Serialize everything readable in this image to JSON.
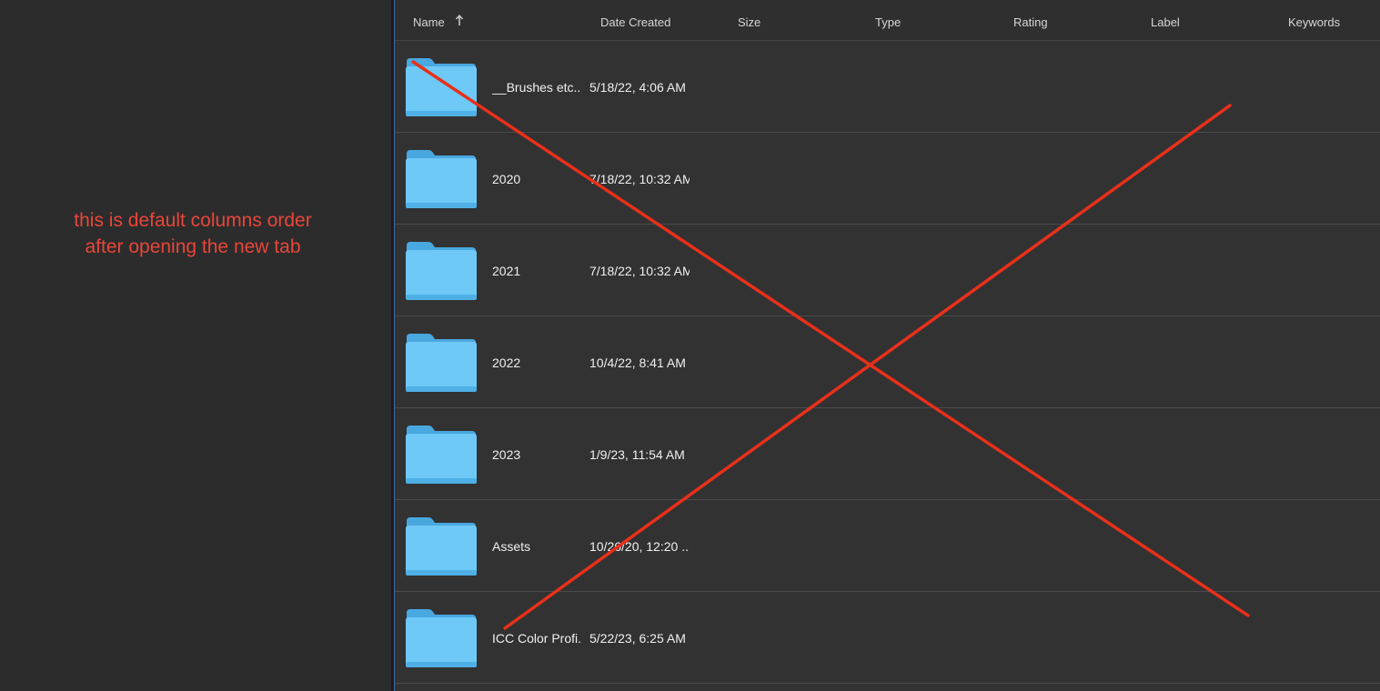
{
  "annotation": {
    "lines": [
      "this is default columns order",
      "after opening the new tab"
    ],
    "color": "#e8463a"
  },
  "columns": [
    {
      "label": "Name"
    },
    {
      "label": "Date Created"
    },
    {
      "label": "Size"
    },
    {
      "label": "Type"
    },
    {
      "label": "Rating"
    },
    {
      "label": "Label"
    },
    {
      "label": "Keywords"
    }
  ],
  "sort": {
    "column": "Name",
    "direction": "ascending",
    "icon": "arrow-up-icon"
  },
  "rows": [
    {
      "name": "__Brushes etc...",
      "date_created": "5/18/22, 4:06 AM",
      "icon": "folder-icon"
    },
    {
      "name": "2020",
      "date_created": "7/18/22, 10:32 AM",
      "icon": "folder-icon"
    },
    {
      "name": "2021",
      "date_created": "7/18/22, 10:32 AM",
      "icon": "folder-icon"
    },
    {
      "name": "2022",
      "date_created": "10/4/22, 8:41 AM",
      "icon": "folder-icon"
    },
    {
      "name": "2023",
      "date_created": "1/9/23, 11:54 AM",
      "icon": "folder-icon"
    },
    {
      "name": "Assets",
      "date_created": "10/26/20, 12:20 ...",
      "icon": "folder-icon"
    },
    {
      "name": "ICC Color Profi...",
      "date_created": "5/22/23, 6:25 AM",
      "icon": "folder-icon"
    }
  ],
  "colors": {
    "folder": "#6ec9f7",
    "cross_mark": "#e8301a",
    "background": "#323232"
  }
}
